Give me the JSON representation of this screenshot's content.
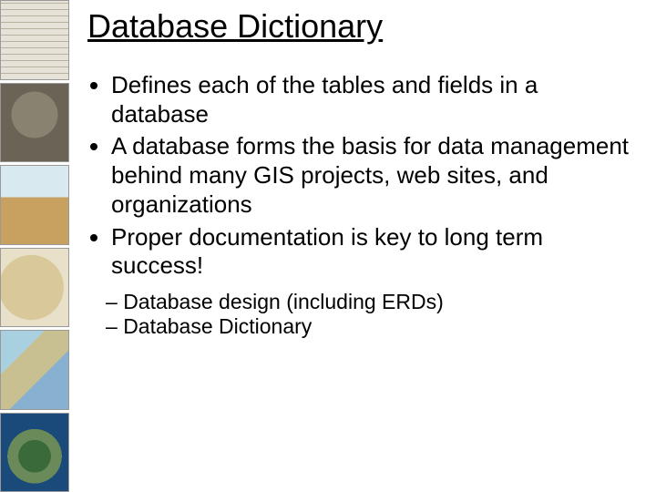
{
  "title": "Database Dictionary",
  "bullets": [
    "Defines each of the tables and fields in a database",
    "A database forms the basis for data management behind many GIS projects, web sites, and organizations",
    "Proper documentation is key to long term success!"
  ],
  "sub_bullets": [
    "Database design (including ERDs)",
    "Database Dictionary"
  ],
  "thumbs": [
    "grid",
    "tablet",
    "painting",
    "old-map",
    "region",
    "globe"
  ]
}
